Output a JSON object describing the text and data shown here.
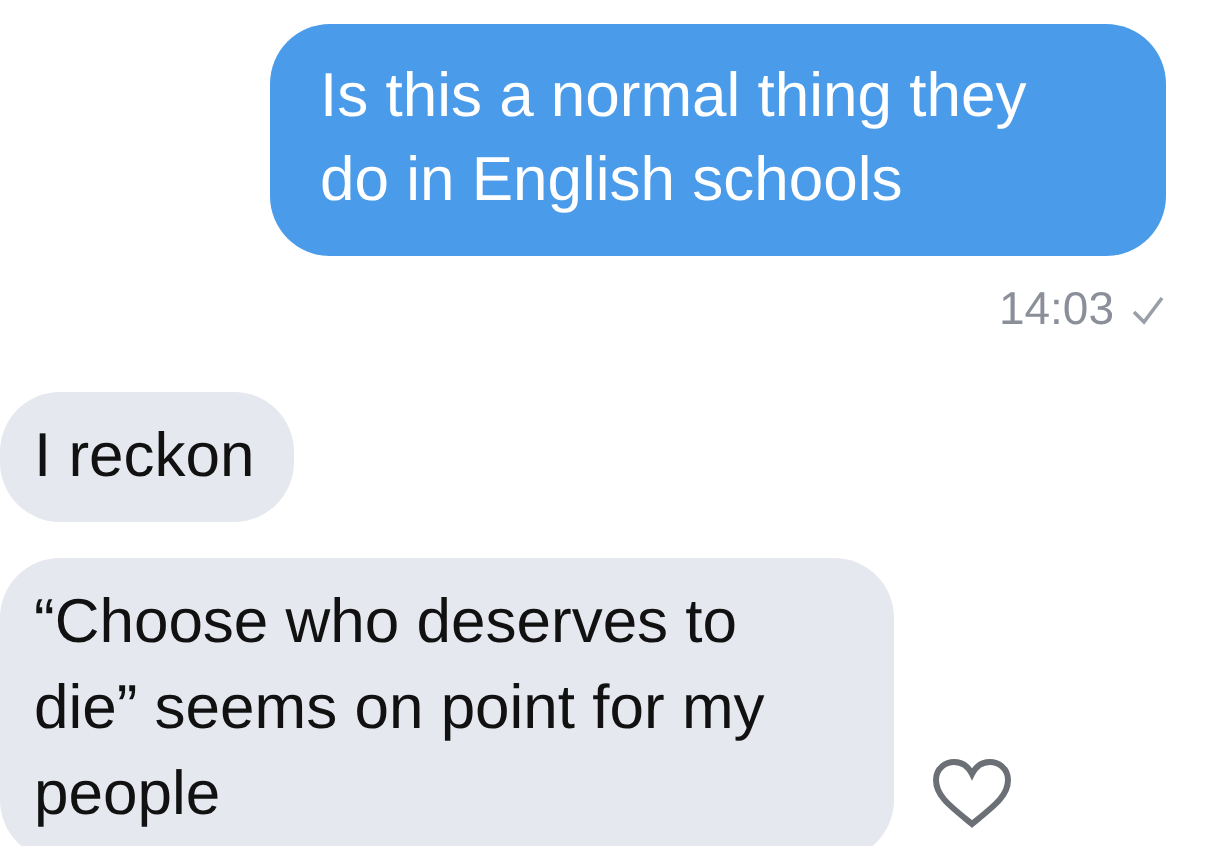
{
  "messages": [
    {
      "kind": "outgoing",
      "text": "Is this a normal thing they do in English schools"
    },
    {
      "kind": "meta",
      "time": "14:03",
      "delivered": true
    },
    {
      "kind": "incoming",
      "text": "I reckon",
      "reaction": false
    },
    {
      "kind": "incoming",
      "text": "“Choose who deserves to die” seems on point for my people",
      "reaction": true
    }
  ]
}
